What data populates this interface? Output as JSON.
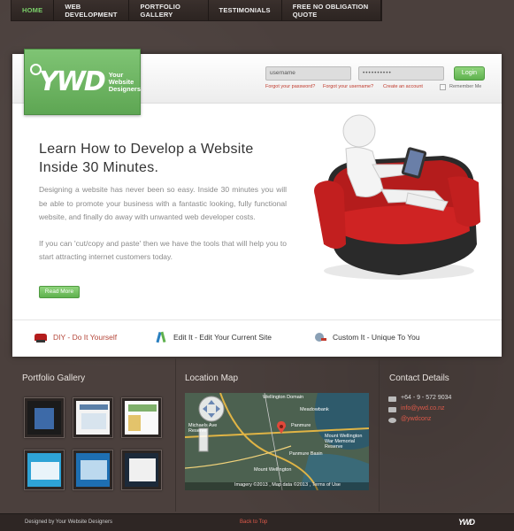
{
  "nav": {
    "items": [
      "HOME",
      "WEB DEVELOPMENT",
      "PORTFOLIO GALLERY",
      "TESTIMONIALS",
      "FREE NO OBLIGATION QUOTE"
    ]
  },
  "logo": {
    "mark": "YWD",
    "subtitle": "Your Website Designers"
  },
  "login": {
    "username_placeholder": "username",
    "password_value": "••••••••••",
    "button": "Login",
    "forgot_password": "Forgot your password?",
    "forgot_username": "Forgot your username?",
    "create_account": "Create an account",
    "remember": "Remember Me"
  },
  "hero": {
    "headline_1": "Learn How to Develop a Website",
    "headline_2": "Inside 30 Minutes.",
    "para1": "Designing a website has never been so easy. Inside 30 minutes you will be able to promote your business with a fantastic looking, fully functional website, and finally do away with unwanted web developer costs.",
    "para2": "If you can 'cut/copy and paste' then we have the tools that will help you to start attracting internet customers today.",
    "read_more": "Read More"
  },
  "features": [
    {
      "label": "DIY - Do It Yourself",
      "color": "#b5473a"
    },
    {
      "label": "Edit It - Edit Your Current Site",
      "color": "#333333"
    },
    {
      "label": "Custom It - Unique To You",
      "color": "#333333"
    }
  ],
  "portfolio": {
    "title": "Portfolio Gallery"
  },
  "map": {
    "title": "Location Map",
    "places": [
      "Wellington Domain",
      "Meadowbank",
      "Michaels Ave Reserve",
      "Panmure",
      "Mount Wellington War Memorial Reserve",
      "Panmure Basin",
      "Mount Wellington"
    ],
    "attribution": "Imagery ©2013 , Map data ©2013 , Terms of Use"
  },
  "contact": {
    "title": "Contact Details",
    "phone": "+64 - 9 - 572 9034",
    "email": "info@ywd.co.nz",
    "twitter": "@ywdconz"
  },
  "footer": {
    "credit": "Designed by Your Website Designers",
    "back_to_top": "Back to Top",
    "logo": "YWD"
  },
  "colors": {
    "accent": "#5fb14e",
    "link": "#c0392b",
    "bg": "#4b403d"
  }
}
